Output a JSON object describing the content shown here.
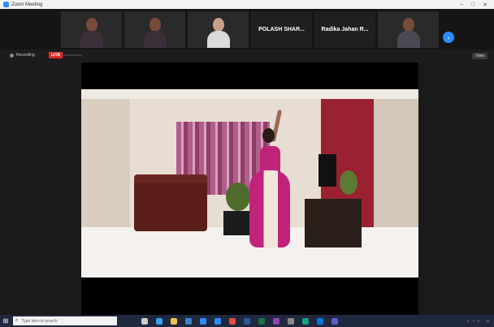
{
  "window": {
    "title": "Zoom Meeting",
    "controls": [
      "–",
      "□",
      "✕"
    ]
  },
  "strip": {
    "participants": [
      {
        "name": "",
        "kind": "video"
      },
      {
        "name": "",
        "kind": "video"
      },
      {
        "name": "",
        "kind": "video"
      },
      {
        "name": "POLASH SHAR...",
        "kind": "name"
      },
      {
        "name": "Radika Jahan R...",
        "kind": "name"
      },
      {
        "name": "",
        "kind": "video"
      }
    ],
    "next_icon": "chevron-right-icon"
  },
  "status": {
    "recording_label": "Recording",
    "live_badge": "LIVE",
    "live_text": "",
    "view_button": "View"
  },
  "main": {
    "presenter_visible": true
  },
  "taskbar": {
    "search_placeholder": "Type here to search",
    "icons": [
      "task-view-icon",
      "edge-icon",
      "file-explorer-icon",
      "store-icon",
      "mail-icon",
      "zoom-icon",
      "chrome-icon",
      "word-icon",
      "excel-icon",
      "photos-icon",
      "settings-icon",
      "media-icon",
      "outlook-icon",
      "teams-icon"
    ],
    "icon_colors": [
      "#cccccc",
      "#3aa0e8",
      "#f2c14e",
      "#3b82c4",
      "#2d8cff",
      "#2d8cff",
      "#e74c3c",
      "#2b579a",
      "#1e7145",
      "#8e44ad",
      "#888888",
      "#16a085",
      "#0078d4",
      "#5b5fc7"
    ],
    "time": "",
    "date": ""
  }
}
